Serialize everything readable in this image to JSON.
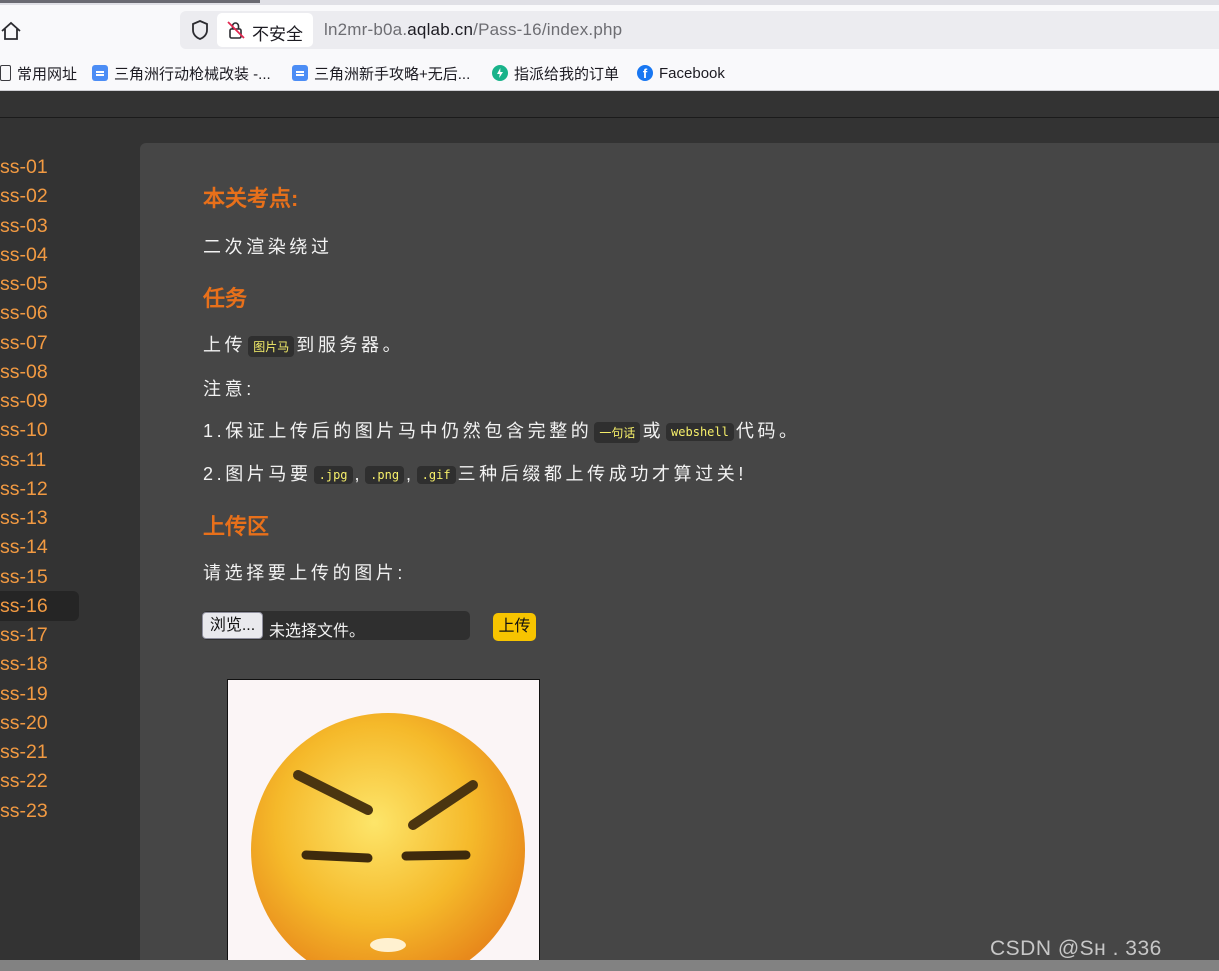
{
  "browser": {
    "insecure_label": "不安全",
    "url_prefix": "ln2mr-b0a.",
    "url_host": "aqlab.cn",
    "url_path": "/Pass-16/index.php"
  },
  "bookmarks": [
    {
      "label": "常用网址",
      "icon": "folder-icon"
    },
    {
      "label": "三角洲行动枪械改装 -...",
      "icon": "doc-icon"
    },
    {
      "label": "三角洲新手攻略+无后...",
      "icon": "doc-icon"
    },
    {
      "label": "指派给我的订单",
      "icon": "bolt-icon"
    },
    {
      "label": "Facebook",
      "icon": "facebook-icon"
    }
  ],
  "sidebar": {
    "items": [
      "ss-01",
      "ss-02",
      "ss-03",
      "ss-04",
      "ss-05",
      "ss-06",
      "ss-07",
      "ss-08",
      "ss-09",
      "ss-10",
      "ss-11",
      "ss-12",
      "ss-13",
      "ss-14",
      "ss-15",
      "ss-16",
      "ss-17",
      "ss-18",
      "ss-19",
      "ss-20",
      "ss-21",
      "ss-22",
      "ss-23"
    ],
    "active": "ss-16"
  },
  "content": {
    "topic_heading": "本关考点:",
    "topic_text": "二次渲染绕过",
    "task_heading": "任务",
    "task_line_prefix": "上传",
    "task_code": "图片马",
    "task_line_suffix": "到服务器。",
    "note_label": "注意:",
    "note1_prefix": "1.保证上传后的图片马中仍然包含完整的",
    "note1_code1": "一句话",
    "note1_mid": "或",
    "note1_code2": "webshell",
    "note1_suffix": "代码。",
    "note2_prefix": "2.图片马要",
    "note2_code1": ".jpg",
    "note2_sep1": ",",
    "note2_code2": ".png",
    "note2_sep2": ",",
    "note2_code3": ".gif",
    "note2_suffix": "三种后缀都上传成功才算过关!",
    "upload_heading": "上传区",
    "upload_prompt": "请选择要上传的图片:",
    "browse_label": "浏览...",
    "file_status": "未选择文件。",
    "upload_button": "上传"
  },
  "watermark": "CSDN @Sн    .  336",
  "colors": {
    "accent_orange": "#e8701a",
    "nav_link": "#f29a42",
    "code_text": "#f7f06a",
    "upload_button": "#f7c400"
  }
}
